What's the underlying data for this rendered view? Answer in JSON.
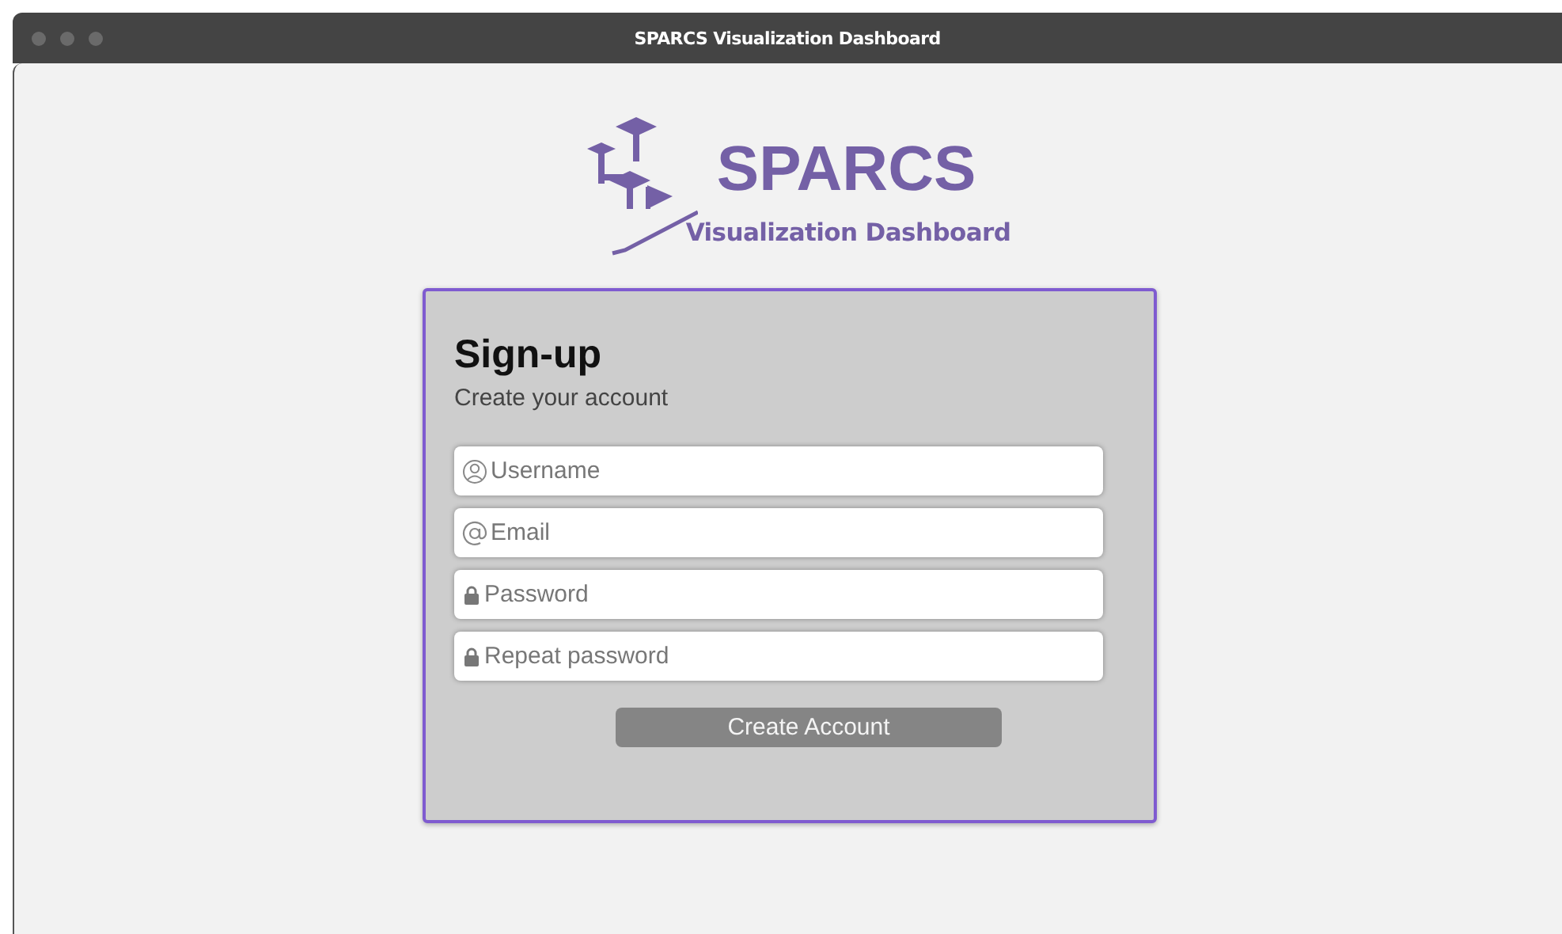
{
  "window": {
    "title": "SPARCS Visualization Dashboard"
  },
  "logo": {
    "name": "SPARCS",
    "subtitle": "Visualization Dashboard"
  },
  "form": {
    "title": "Sign-up",
    "subtitle": "Create your account",
    "fields": [
      {
        "placeholder": "Username",
        "kind": "user"
      },
      {
        "placeholder": "Email",
        "kind": "email"
      },
      {
        "placeholder": "Password",
        "kind": "password"
      },
      {
        "placeholder": "Repeat password",
        "kind": "password"
      }
    ],
    "button": "Create Account"
  }
}
